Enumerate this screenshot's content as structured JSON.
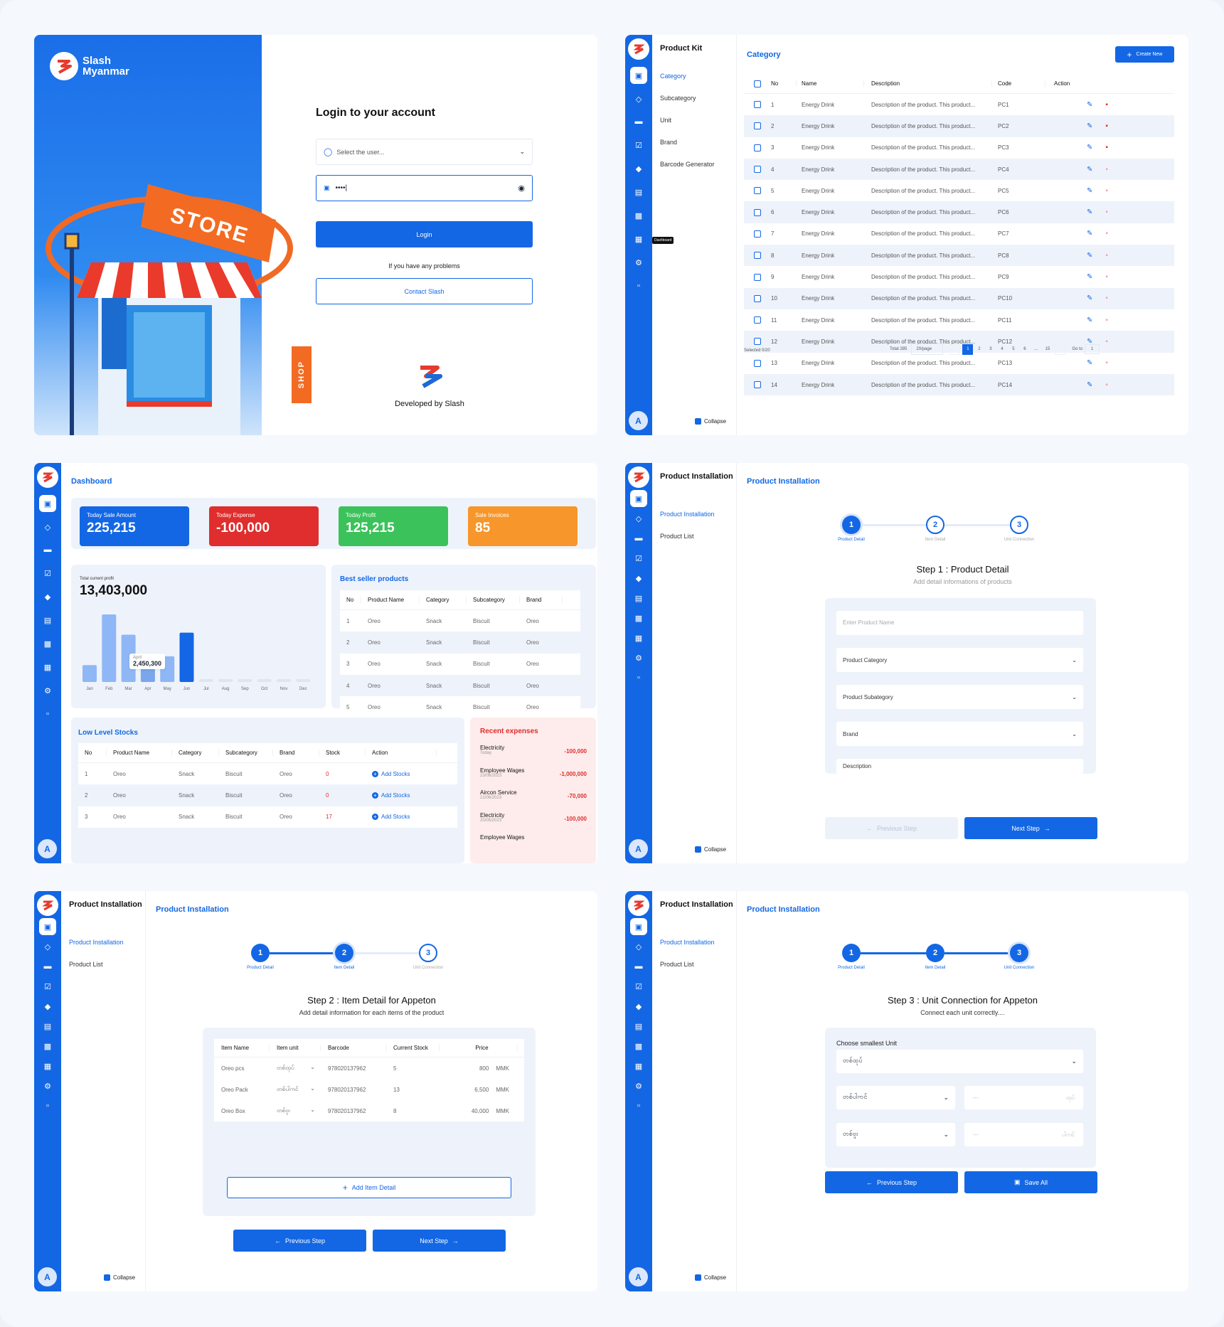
{
  "login": {
    "brand_line1": "Slash",
    "brand_line2": "Myanmar",
    "title": "Login to your account",
    "user_placeholder": "Select the user...",
    "password_value": "••••|",
    "login_label": "Login",
    "problem_text": "If you have any problems",
    "contact_label": "Contact Slash",
    "dev_text": "Developed by Slash",
    "store_sign": "STORE",
    "shop_sign": "SHOP"
  },
  "kit": {
    "sub_title": "Product Kit",
    "menu": [
      "Category",
      "Subcategory",
      "Unit",
      "Brand",
      "Barcode Generator"
    ],
    "title": "Category",
    "create_label": "Create New",
    "headers": [
      "No",
      "Name",
      "Description",
      "Code",
      "Action"
    ],
    "rows": [
      {
        "no": "1",
        "name": "Energy Drink",
        "desc": "Description of the product. This product...",
        "code": "PC1"
      },
      {
        "no": "2",
        "name": "Energy Drink",
        "desc": "Description of the product. This product...",
        "code": "PC2"
      },
      {
        "no": "3",
        "name": "Energy Drink",
        "desc": "Description of the product. This product...",
        "code": "PC3"
      },
      {
        "no": "4",
        "name": "Energy Drink",
        "desc": "Description of the product. This product...",
        "code": "PC4"
      },
      {
        "no": "5",
        "name": "Energy Drink",
        "desc": "Description of the product. This product...",
        "code": "PC5"
      },
      {
        "no": "6",
        "name": "Energy Drink",
        "desc": "Description of the product. This product...",
        "code": "PC6"
      },
      {
        "no": "7",
        "name": "Energy Drink",
        "desc": "Description of the product. This product...",
        "code": "PC7"
      },
      {
        "no": "8",
        "name": "Energy Drink",
        "desc": "Description of the product. This product...",
        "code": "PC8"
      },
      {
        "no": "9",
        "name": "Energy Drink",
        "desc": "Description of the product. This product...",
        "code": "PC9"
      },
      {
        "no": "10",
        "name": "Energy Drink",
        "desc": "Description of the product. This product...",
        "code": "PC10"
      },
      {
        "no": "11",
        "name": "Energy Drink",
        "desc": "Description of the product. This product...",
        "code": "PC11"
      },
      {
        "no": "12",
        "name": "Energy Drink",
        "desc": "Description of the product. This product...",
        "code": "PC12"
      },
      {
        "no": "13",
        "name": "Energy Drink",
        "desc": "Description of the product. This product...",
        "code": "PC13"
      },
      {
        "no": "14",
        "name": "Energy Drink",
        "desc": "Description of the product. This product...",
        "code": "PC14"
      }
    ],
    "selected": "Selected 0/20",
    "total": "Total 285",
    "per_page": "20/page",
    "pages": [
      "1",
      "2",
      "3",
      "4",
      "5",
      "6",
      "...",
      "15"
    ],
    "goto_label": "Go to",
    "goto_value": "1",
    "tooltip": "Dashboard",
    "collapse": "Collapse",
    "avatar": "A"
  },
  "dash": {
    "title": "Dashboard",
    "stats": [
      {
        "label": "Today Sale Amount",
        "value": "225,215",
        "color": "#1367e4"
      },
      {
        "label": "Today Expense",
        "value": "-100,000",
        "color": "#e02d2d"
      },
      {
        "label": "Today Profit",
        "value": "125,215",
        "color": "#3cc25a"
      },
      {
        "label": "Sale Invoices",
        "value": "85",
        "color": "#f7962a"
      }
    ],
    "profit_label": "Total current profit",
    "profit_value": "13,403,000",
    "tooltip_month": "April",
    "tooltip_value": "2,450,300",
    "best_title": "Best seller products",
    "best_headers": [
      "No",
      "Product Name",
      "Category",
      "Subcategory",
      "Brand"
    ],
    "best_rows": [
      [
        "1",
        "Oreo",
        "Snack",
        "Biscuit",
        "Oreo"
      ],
      [
        "2",
        "Oreo",
        "Snack",
        "Biscuit",
        "Oreo"
      ],
      [
        "3",
        "Oreo",
        "Snack",
        "Biscuit",
        "Oreo"
      ],
      [
        "4",
        "Oreo",
        "Snack",
        "Biscuit",
        "Oreo"
      ],
      [
        "5",
        "Oreo",
        "Snack",
        "Biscuit",
        "Oreo"
      ]
    ],
    "low_title": "Low Level Stocks",
    "low_headers": [
      "No",
      "Product Name",
      "Category",
      "Subcategory",
      "Brand",
      "Stock",
      "Action"
    ],
    "low_rows": [
      [
        "1",
        "Oreo",
        "Snack",
        "Biscuit",
        "Oreo",
        "0"
      ],
      [
        "2",
        "Oreo",
        "Snack",
        "Biscuit",
        "Oreo",
        "0"
      ],
      [
        "3",
        "Oreo",
        "Snack",
        "Biscuit",
        "Oreo",
        "17"
      ]
    ],
    "add_stocks": "Add Stocks",
    "exp_title": "Recent expenses",
    "expenses": [
      {
        "name": "Electricity",
        "date": "Today",
        "amount": "-100,000"
      },
      {
        "name": "Employee Wages",
        "date": "23/06/2023",
        "amount": "-1,000,000"
      },
      {
        "name": "Aircon Service",
        "date": "21/06/2023",
        "amount": "-70,000"
      },
      {
        "name": "Electricity",
        "date": "20/05/2023",
        "amount": "-100,000"
      },
      {
        "name": "Employee Wages",
        "date": "",
        "amount": ""
      }
    ],
    "avatar": "A"
  },
  "chart_data": {
    "type": "bar",
    "categories": [
      "Jan",
      "Feb",
      "Mar",
      "Apr",
      "May",
      "Jun",
      "Jul",
      "Aug",
      "Sep",
      "Oct",
      "Nov",
      "Dec"
    ],
    "values": [
      0.25,
      1.0,
      0.7,
      0.38,
      0.38,
      0.73,
      0.02,
      0.02,
      0.02,
      0.02,
      0.02,
      0.02
    ],
    "highlight": "Jun",
    "ylim": [
      0,
      1
    ]
  },
  "install": {
    "sub_title": "Product Installation",
    "menu": [
      "Product Installation",
      "Product List"
    ],
    "title": "Product Installation",
    "steps": [
      "Product Detail",
      "Item Detail",
      "Unit Connection"
    ],
    "collapse": "Collapse",
    "avatar": "A",
    "s1": {
      "heading": "Step 1 : Product Detail",
      "sub": "Add detail informations of products",
      "fields": [
        "Enter Product Name",
        "Product Category",
        "Product Subategory",
        "Brand",
        "Description"
      ],
      "prev": "Previous Step",
      "next": "Next Step"
    },
    "s2": {
      "heading": "Step 2 : Item Detail for Appeton",
      "sub": "Add detail information for each items of the product",
      "headers": [
        "Item Name",
        "Item unit",
        "Barcode",
        "Current Stock",
        "Price"
      ],
      "rows": [
        [
          "Oreo pcs",
          "တစ်ထုပ်",
          "978020137962",
          "5",
          "800",
          "MMK"
        ],
        [
          "Oreo Pack",
          "တစ်ပါကင်",
          "978020137962",
          "13",
          "6,500",
          "MMK"
        ],
        [
          "Oreo Box",
          "တစ်ဗူး",
          "978020137962",
          "8",
          "40,000",
          "MMK"
        ]
      ],
      "add_item": "Add Item Detail",
      "prev": "Previous Step",
      "next": "Next Step"
    },
    "s3": {
      "heading": "Step 3 : Unit Connection for Appeton",
      "sub": "Connect each unit correctly....",
      "choose": "Choose smallest Unit",
      "smallest": "တစ်ထုပ်",
      "rows": [
        {
          "unit": "တစ်ပါကင်",
          "ph": "---",
          "suffix": "ထုပ်"
        },
        {
          "unit": "တစ်ဗူး",
          "ph": "---",
          "suffix": "ပါကင်"
        }
      ],
      "prev": "Previous Step",
      "save": "Save All"
    }
  }
}
